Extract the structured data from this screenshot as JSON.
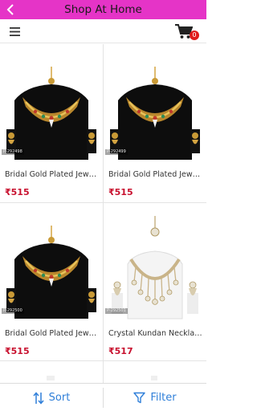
{
  "titlebar": {
    "title": "Shop At Home",
    "back_icon": "chevron-left-icon"
  },
  "toolbar": {
    "menu_icon": "hamburger-menu-icon",
    "cart_icon": "shopping-cart-icon",
    "cart_count": "0"
  },
  "products": [
    {
      "name": "Bridal Gold Plated Jewell...",
      "price": "₹515",
      "sku": "P-292498",
      "style": "gold"
    },
    {
      "name": "Bridal Gold Plated Jewell...",
      "price": "₹515",
      "sku": "P-292499",
      "style": "gold"
    },
    {
      "name": "Bridal Gold Plated Jewell...",
      "price": "₹515",
      "sku": "P-292500",
      "style": "gold"
    },
    {
      "name": "Crystal Kundan Necklace ...",
      "price": "₹517",
      "sku": "P-292501",
      "style": "kundan"
    }
  ],
  "bottombar": {
    "sort_label": "Sort",
    "sort_icon": "sort-arrows-icon",
    "filter_label": "Filter",
    "filter_icon": "funnel-icon"
  },
  "colors": {
    "titlebar_bg": "#e534c7",
    "price": "#c8102e",
    "accent": "#2f7fd9",
    "badge": "#e01b1b"
  }
}
